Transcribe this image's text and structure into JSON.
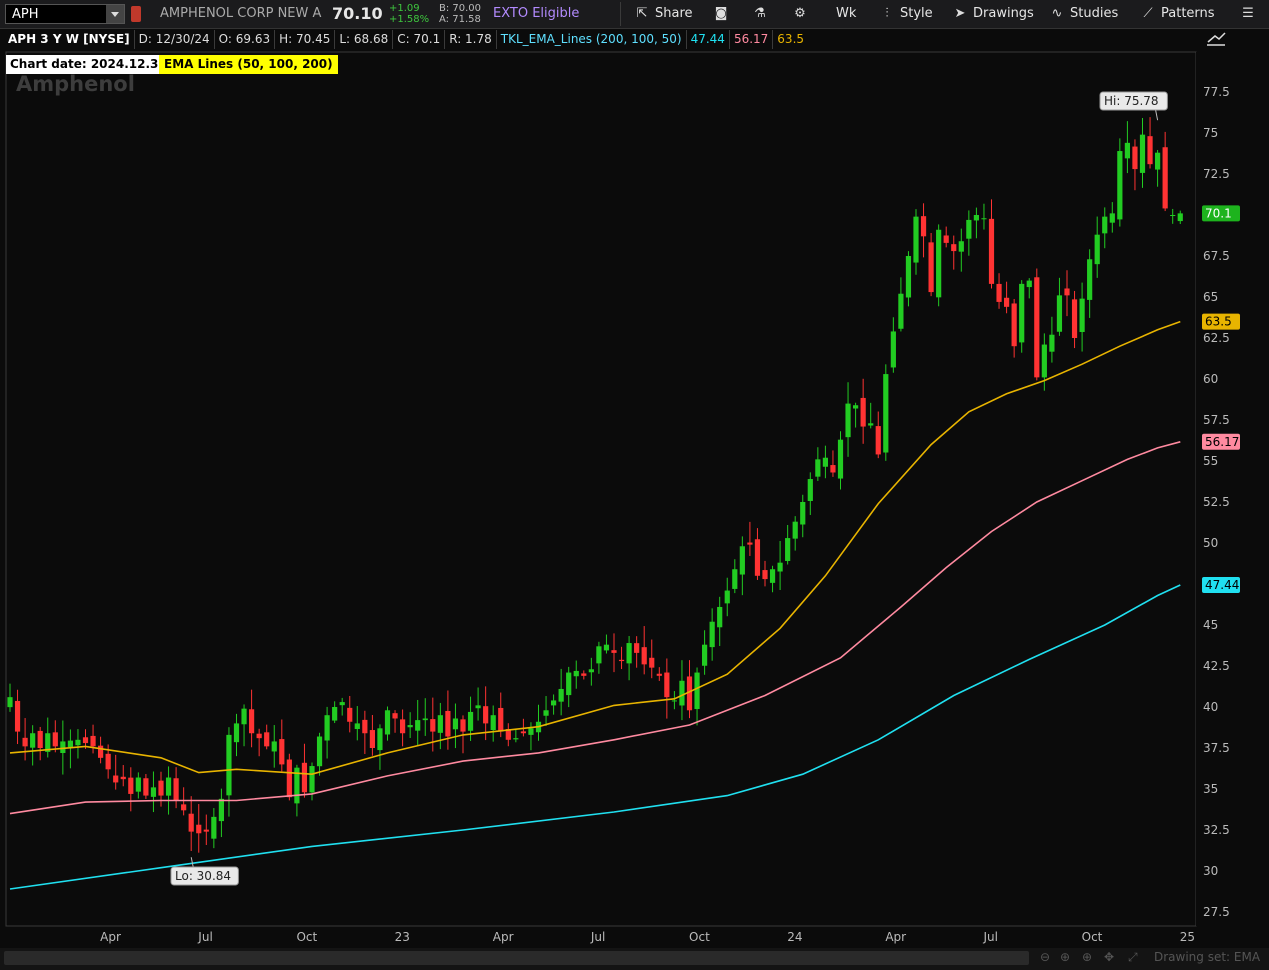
{
  "toolbar": {
    "symbol": "APH",
    "company": "AMPHENOL CORP NEW A",
    "last": "70.10",
    "change": "+1.09",
    "change_pct": "+1.58%",
    "bid": "B: 70.00",
    "ask": "A: 71.58",
    "exto": "EXTO Eligible",
    "share": "Share",
    "period": "Wk",
    "style": "Style",
    "drawings": "Drawings",
    "studies": "Studies",
    "patterns": "Patterns"
  },
  "status": {
    "symbol": "APH 3 Y W [NYSE]",
    "date": "D: 12/30/24",
    "open": "O: 69.63",
    "high": "H: 70.45",
    "low": "L: 68.68",
    "close": "C: 70.1",
    "range": "R: 1.78",
    "indicator": "TKL_EMA_Lines (200, 100, 50)",
    "v200": "47.44",
    "v100": "56.17",
    "v50": "63.5"
  },
  "labels": {
    "chart_date": "Chart date:  2024.12.30",
    "ema_lines": "EMA Lines (50, 100, 200)",
    "watermark": "Amphenol",
    "hi": "Hi: 75.78",
    "lo": "Lo: 30.84",
    "last_price": "70.1",
    "drawing_set": "Drawing set: EMA"
  },
  "colors": {
    "up": "#22cc22",
    "down": "#ff3333",
    "ema50": "#e8b400",
    "ema100": "#ff8aa0",
    "ema200": "#20e0f0",
    "background": "#0b0b0b"
  },
  "chart_data": {
    "type": "candlestick",
    "title": "APH 3 Y W [NYSE]",
    "ylim": [
      26.5,
      79
    ],
    "y_ticks": [
      27.5,
      30,
      32.5,
      35,
      37.5,
      40,
      42.5,
      45,
      47.5,
      50,
      52.5,
      55,
      57.5,
      60,
      62.5,
      65,
      67.5,
      70,
      72.5,
      75,
      77.5
    ],
    "x_ticks": [
      {
        "label": "Apr",
        "week": 13
      },
      {
        "label": "Jul",
        "week": 26
      },
      {
        "label": "Oct",
        "week": 39
      },
      {
        "label": "23",
        "week": 52
      },
      {
        "label": "Apr",
        "week": 65
      },
      {
        "label": "Jul",
        "week": 78
      },
      {
        "label": "Oct",
        "week": 91
      },
      {
        "label": "24",
        "week": 104
      },
      {
        "label": "Apr",
        "week": 117
      },
      {
        "label": "Jul",
        "week": 130
      },
      {
        "label": "Oct",
        "week": 143
      },
      {
        "label": "25",
        "week": 156
      }
    ],
    "weeks": 155,
    "close_path": [
      [
        0,
        40.6
      ],
      [
        1,
        38.5
      ],
      [
        2,
        37.6
      ],
      [
        3,
        38.4
      ],
      [
        4,
        37.5
      ],
      [
        5,
        38.4
      ],
      [
        6,
        37.6
      ],
      [
        7,
        37.9
      ],
      [
        9,
        38.0
      ],
      [
        10,
        37.8
      ],
      [
        11,
        37.6
      ],
      [
        13,
        36.2
      ],
      [
        14,
        35.4
      ],
      [
        15,
        35.6
      ],
      [
        16,
        34.7
      ],
      [
        17,
        35.7
      ],
      [
        18,
        34.6
      ],
      [
        19,
        35.1
      ],
      [
        20,
        34.6
      ],
      [
        21,
        35.7
      ],
      [
        22,
        34.3
      ],
      [
        23,
        33.7
      ],
      [
        24,
        32.4
      ],
      [
        25,
        32.3
      ],
      [
        26,
        32.4
      ],
      [
        27,
        33.3
      ],
      [
        28,
        34.4
      ],
      [
        29,
        38.3
      ],
      [
        30,
        39.0
      ],
      [
        31,
        39.9
      ],
      [
        32,
        38.4
      ],
      [
        33,
        38.1
      ],
      [
        34,
        37.6
      ],
      [
        35,
        37.9
      ],
      [
        36,
        36.5
      ],
      [
        37,
        34.5
      ],
      [
        38,
        36.3
      ],
      [
        39,
        34.8
      ],
      [
        40,
        36.4
      ],
      [
        41,
        38.2
      ],
      [
        42,
        39.5
      ],
      [
        43,
        40.0
      ],
      [
        44,
        40.3
      ],
      [
        45,
        39.1
      ],
      [
        46,
        39.0
      ],
      [
        47,
        38.4
      ],
      [
        48,
        37.5
      ],
      [
        49,
        38.7
      ],
      [
        50,
        39.8
      ],
      [
        51,
        39.3
      ],
      [
        52,
        38.4
      ],
      [
        53,
        38.9
      ],
      [
        54,
        39.2
      ],
      [
        55,
        39.3
      ],
      [
        56,
        38.5
      ],
      [
        57,
        39.5
      ],
      [
        58,
        38.2
      ],
      [
        59,
        39.3
      ],
      [
        60,
        38.5
      ],
      [
        61,
        39.7
      ],
      [
        62,
        40.1
      ],
      [
        63,
        39.0
      ],
      [
        64,
        39.5
      ],
      [
        65,
        38.5
      ],
      [
        66,
        38.0
      ],
      [
        67,
        38.1
      ],
      [
        68,
        38.4
      ],
      [
        69,
        38.7
      ],
      [
        70,
        39.1
      ],
      [
        71,
        39.8
      ],
      [
        72,
        40.4
      ],
      [
        73,
        41.1
      ],
      [
        74,
        42.1
      ],
      [
        75,
        42.2
      ],
      [
        76,
        41.9
      ],
      [
        77,
        42.3
      ],
      [
        78,
        43.7
      ],
      [
        79,
        43.8
      ],
      [
        80,
        43.3
      ],
      [
        81,
        42.8
      ],
      [
        82,
        43.9
      ],
      [
        83,
        43.3
      ],
      [
        84,
        42.6
      ],
      [
        85,
        42.4
      ],
      [
        86,
        41.9
      ],
      [
        87,
        40.6
      ],
      [
        88,
        40.4
      ],
      [
        89,
        41.6
      ],
      [
        90,
        39.8
      ],
      [
        91,
        42.1
      ],
      [
        92,
        43.8
      ],
      [
        93,
        45.2
      ],
      [
        94,
        46.1
      ],
      [
        95,
        47.1
      ],
      [
        96,
        48.4
      ],
      [
        97,
        49.8
      ],
      [
        98,
        49.9
      ],
      [
        99,
        48.0
      ],
      [
        100,
        47.8
      ],
      [
        101,
        48.4
      ],
      [
        102,
        48.8
      ],
      [
        103,
        50.3
      ],
      [
        104,
        51.3
      ],
      [
        105,
        52.5
      ],
      [
        106,
        53.9
      ],
      [
        107,
        55.1
      ],
      [
        108,
        55.2
      ],
      [
        109,
        54.3
      ],
      [
        110,
        56.3
      ],
      [
        111,
        58.5
      ],
      [
        112,
        58.4
      ],
      [
        113,
        57.1
      ],
      [
        114,
        57.3
      ],
      [
        115,
        55.4
      ],
      [
        116,
        60.3
      ],
      [
        117,
        62.9
      ],
      [
        118,
        65.2
      ],
      [
        119,
        67.5
      ],
      [
        120,
        69.9
      ],
      [
        121,
        68.7
      ],
      [
        122,
        65.3
      ],
      [
        123,
        69.1
      ],
      [
        124,
        68.3
      ],
      [
        125,
        67.8
      ],
      [
        126,
        68.4
      ],
      [
        127,
        69.7
      ],
      [
        128,
        70.0
      ],
      [
        129,
        69.8
      ],
      [
        130,
        65.8
      ],
      [
        131,
        64.7
      ],
      [
        132,
        64.4
      ],
      [
        133,
        62.0
      ],
      [
        134,
        65.8
      ],
      [
        135,
        66.0
      ],
      [
        136,
        60.1
      ],
      [
        137,
        62.1
      ],
      [
        138,
        62.7
      ],
      [
        139,
        65.1
      ],
      [
        140,
        65.1
      ],
      [
        141,
        62.5
      ],
      [
        142,
        64.9
      ],
      [
        143,
        67.3
      ],
      [
        144,
        68.8
      ],
      [
        145,
        69.9
      ],
      [
        146,
        70.1
      ],
      [
        147,
        73.9
      ],
      [
        148,
        74.4
      ],
      [
        149,
        72.8
      ],
      [
        150,
        74.9
      ],
      [
        151,
        73.1
      ],
      [
        152,
        73.8
      ],
      [
        153,
        70.4
      ],
      [
        154,
        70.0
      ],
      [
        155,
        70.1
      ]
    ],
    "ema50": [
      [
        0,
        37.2
      ],
      [
        10,
        37.6
      ],
      [
        20,
        36.9
      ],
      [
        25,
        36.0
      ],
      [
        30,
        36.2
      ],
      [
        40,
        35.9
      ],
      [
        50,
        37.2
      ],
      [
        60,
        38.3
      ],
      [
        70,
        38.8
      ],
      [
        80,
        40.1
      ],
      [
        88,
        40.5
      ],
      [
        95,
        42.0
      ],
      [
        102,
        44.8
      ],
      [
        108,
        48.0
      ],
      [
        115,
        52.4
      ],
      [
        122,
        56.0
      ],
      [
        127,
        58.0
      ],
      [
        132,
        59.1
      ],
      [
        137,
        59.9
      ],
      [
        142,
        60.9
      ],
      [
        147,
        62.0
      ],
      [
        152,
        63.0
      ],
      [
        155,
        63.5
      ]
    ],
    "ema100": [
      [
        0,
        33.5
      ],
      [
        10,
        34.2
      ],
      [
        20,
        34.3
      ],
      [
        30,
        34.3
      ],
      [
        40,
        34.7
      ],
      [
        50,
        35.8
      ],
      [
        60,
        36.7
      ],
      [
        70,
        37.2
      ],
      [
        80,
        38.0
      ],
      [
        90,
        38.9
      ],
      [
        100,
        40.7
      ],
      [
        110,
        43.0
      ],
      [
        118,
        46.1
      ],
      [
        124,
        48.5
      ],
      [
        130,
        50.7
      ],
      [
        136,
        52.5
      ],
      [
        142,
        53.8
      ],
      [
        148,
        55.1
      ],
      [
        152,
        55.8
      ],
      [
        155,
        56.17
      ]
    ],
    "ema200": [
      [
        0,
        28.9
      ],
      [
        20,
        30.2
      ],
      [
        40,
        31.5
      ],
      [
        60,
        32.5
      ],
      [
        80,
        33.6
      ],
      [
        95,
        34.6
      ],
      [
        105,
        35.9
      ],
      [
        115,
        38.0
      ],
      [
        125,
        40.7
      ],
      [
        135,
        42.9
      ],
      [
        145,
        45.0
      ],
      [
        152,
        46.8
      ],
      [
        155,
        47.44
      ]
    ],
    "hi": {
      "week": 152,
      "value": 75.78
    },
    "lo": {
      "week": 24,
      "value": 30.84
    }
  }
}
